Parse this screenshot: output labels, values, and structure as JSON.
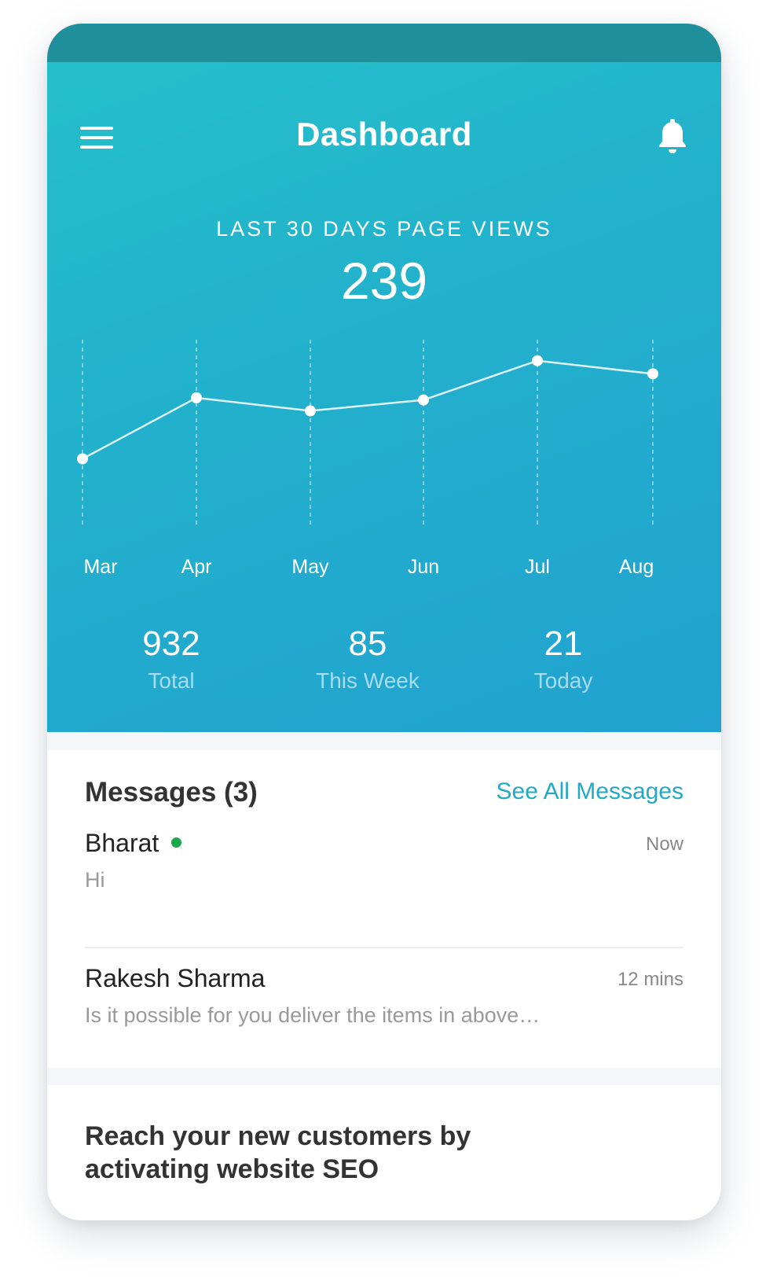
{
  "header": {
    "title": "Dashboard"
  },
  "icons": {
    "menu": "menu-icon",
    "notifications": "bell-icon"
  },
  "kpi": {
    "label": "LAST 30 DAYS PAGE VIEWS",
    "value": "239"
  },
  "chart_data": {
    "type": "line",
    "categories": [
      "Mar",
      "Apr",
      "May",
      "Jun",
      "Jul",
      "Aug"
    ],
    "values": [
      20,
      48,
      42,
      47,
      65,
      59
    ],
    "ylim": [
      0,
      75
    ],
    "grid": "vertical dashed",
    "title": "",
    "xlabel": "",
    "ylabel": ""
  },
  "stats": [
    {
      "value": "932",
      "label": "Total"
    },
    {
      "value": "85",
      "label": "This Week"
    },
    {
      "value": "21",
      "label": "Today"
    }
  ],
  "messages": {
    "title": "Messages (3)",
    "see_all": "See All Messages",
    "items": [
      {
        "name": "Bharat",
        "online": true,
        "text": "Hi",
        "time": "Now"
      },
      {
        "name": "Rakesh Sharma",
        "online": false,
        "text": "Is it possible for you deliver the items in above…",
        "time": "12 mins"
      }
    ]
  },
  "promo": {
    "title": "Reach your new customers by activating website SEO"
  },
  "colors": {
    "accent": "#22a9c6",
    "hero_start": "#25bfca",
    "hero_end": "#21a2d0",
    "online": "#1aa64a"
  }
}
